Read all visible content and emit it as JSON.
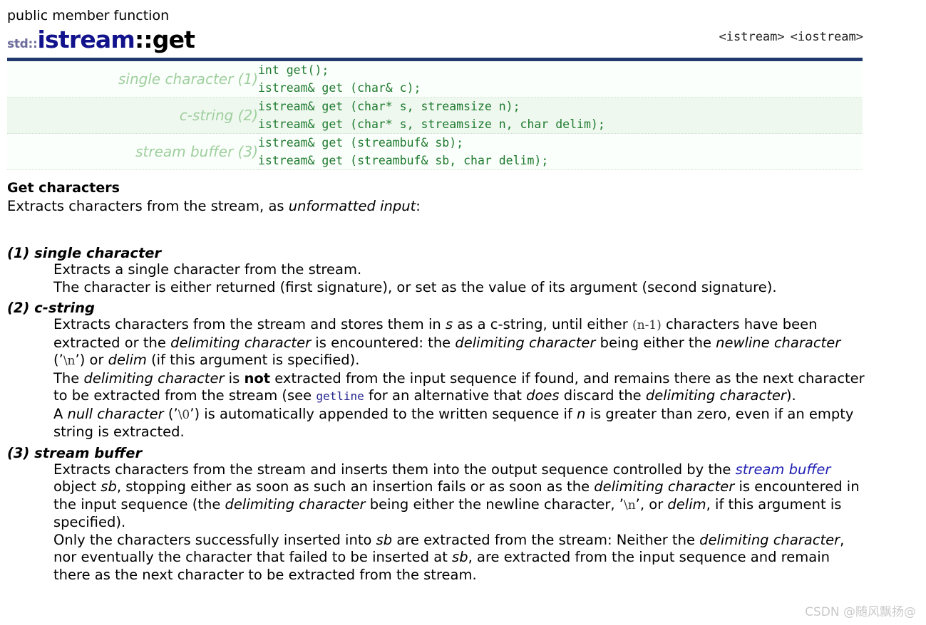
{
  "header": {
    "kind": "public member function",
    "namespace": "std::",
    "class_name": "istream",
    "scope_sep": "::",
    "member_name": "get",
    "include_1": "<istream>",
    "include_2": "<iostream>",
    "rule_color": "#21386f",
    "title_color": "#12128c",
    "ns_color": "#6d6d9c"
  },
  "signatures": {
    "rows": [
      {
        "label": "single character (1)",
        "code": "int get();\nistream& get (char& c);"
      },
      {
        "label": "c-string (2)",
        "code": "istream& get (char* s, streamsize n);\nistream& get (char* s, streamsize n, char delim);"
      },
      {
        "label": "stream buffer (3)",
        "code": "istream& get (streambuf& sb);\nistream& get (streambuf& sb, char delim);"
      }
    ],
    "label_color": "#9fcf9f",
    "code_color": "#1d7a2e"
  },
  "body": {
    "heading": "Get characters",
    "lead_1": "Extracts characters from the stream, as ",
    "lead_em": "unformatted input",
    "lead_2": ":"
  },
  "overloads": [
    {
      "title": "(1) single character",
      "lines": [
        "Extracts a single character from the stream.",
        "The character is either returned (first signature), or set as the value of its argument (second signature)."
      ]
    },
    {
      "title": "(2) c-string",
      "p1_a": "Extracts characters from the stream and stores them in ",
      "p1_s": "s",
      "p1_b": " as a c-string, until either ",
      "p1_n1": "(n-1)",
      "p1_c": " characters have been extracted or the ",
      "p1_delim1": "delimiting character",
      "p1_d": " is encountered: the ",
      "p1_delim2": "delimiting character",
      "p1_e": " being either the ",
      "p1_newline": "newline character",
      "p1_f": " (’",
      "p1_nl": "\\n",
      "p1_g": "’) or ",
      "p1_delimarg": "delim",
      "p1_h": " (if this argument is specified).",
      "p2_a": "The ",
      "p2_delim": "delimiting character",
      "p2_b": " is ",
      "p2_not": "not",
      "p2_c": " extracted from the input sequence if found, and remains there as the next character to be extracted from the stream (see ",
      "p2_link": "getline",
      "p2_d": " for an alternative that ",
      "p2_does": "does",
      "p2_e": " discard the ",
      "p2_delim2": "delimiting character",
      "p2_f": ").",
      "p3_a": "A ",
      "p3_null": "null character",
      "p3_b": " (’",
      "p3_nul": "\\0",
      "p3_c": "’) is automatically appended to the written sequence if ",
      "p3_n": "n",
      "p3_d": " is greater than zero, even if an empty string is extracted."
    },
    {
      "title": "(3) stream buffer",
      "p1_a": "Extracts characters from the stream and inserts them into the output sequence controlled by the ",
      "p1_link": "stream buffer",
      "p1_b": " object ",
      "p1_sb": "sb",
      "p1_c": ", stopping either as soon as such an insertion fails or as soon as the ",
      "p1_delim": "delimiting character",
      "p1_d": " is encountered in the input sequence (the ",
      "p1_delim2": "delimiting character",
      "p1_e": " being either the newline character, ’",
      "p1_nl": "\\n",
      "p1_f": "’, or ",
      "p1_delimarg": "delim",
      "p1_g": ", if this argument is specified).",
      "p2_a": "Only the characters successfully inserted into ",
      "p2_sb1": "sb",
      "p2_b": " are extracted from the stream: Neither the ",
      "p2_delim": "delimiting character",
      "p2_c": ", nor eventually the character that failed to be inserted at ",
      "p2_sb2": "sb",
      "p2_d": ", are extracted from the input sequence and remain there as the next character to be extracted from the stream."
    }
  ],
  "watermark": "CSDN @随风飘扬@"
}
